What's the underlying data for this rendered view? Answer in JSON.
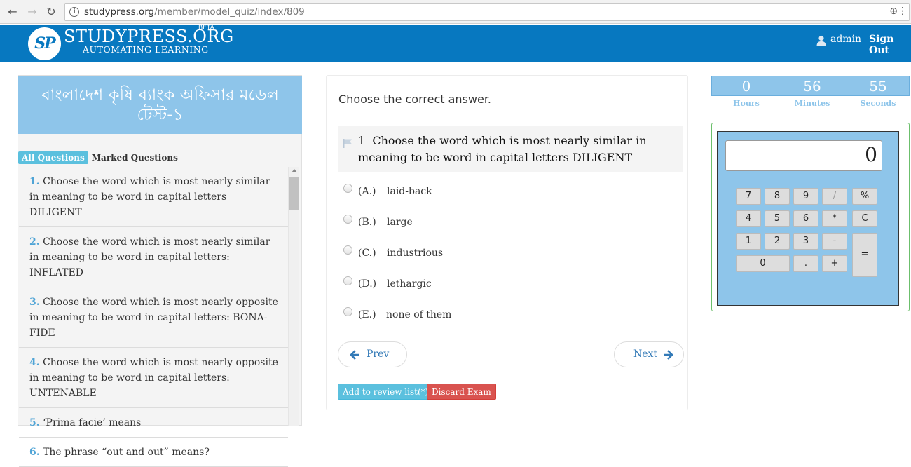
{
  "browser": {
    "url_domain": "studypress.org",
    "url_path": "/member/model_quiz/index/809"
  },
  "header": {
    "logo_mark": "SP",
    "logo_name": "STUDYPRESS.ORG",
    "logo_badge": "BETA",
    "logo_tagline": "AUTOMATING LEARNING",
    "user": "admin",
    "signout": "Sign Out"
  },
  "sidebar": {
    "exam_title": "বাংলাদেশ কৃষি ব্যাংক অফিসার মডেল টেস্ট-১",
    "tab_all": "All Questions",
    "tab_marked": "Marked Questions",
    "questions": [
      {
        "num": "1.",
        "text": "Choose the word which is most nearly similar in meaning to be word in capital letters DILIGENT"
      },
      {
        "num": "2.",
        "text": "Choose the word which is most nearly similar in meaning to be word in capital letters: INFLATED"
      },
      {
        "num": "3.",
        "text": "Choose the word which is most nearly opposite in meaning to be word in capital letters: BONA-FIDE"
      },
      {
        "num": "4.",
        "text": "Choose the word which is most nearly opposite in meaning to be word in capital letters: UNTENABLE"
      },
      {
        "num": "5.",
        "text": "‘Prima facie’ means"
      },
      {
        "num": "6.",
        "text": "The phrase “out and out” means?"
      }
    ]
  },
  "main": {
    "instruction": "Choose the correct answer.",
    "question_number": "1",
    "question_text": "Choose the word which is most nearly similar in meaning to be word in capital letters DILIGENT",
    "options": [
      {
        "letter": "(A.)",
        "text": "laid-back"
      },
      {
        "letter": "(B.)",
        "text": "large"
      },
      {
        "letter": "(C.)",
        "text": "industrious"
      },
      {
        "letter": "(D.)",
        "text": "lethargic"
      },
      {
        "letter": "(E.)",
        "text": "none of them"
      }
    ],
    "prev_label": "Prev",
    "next_label": "Next",
    "review_label": "Add to review list(*)",
    "discard_label": "Discard Exam"
  },
  "timer": {
    "hours": "0",
    "minutes": "56",
    "seconds": "55",
    "hours_label": "Hours",
    "minutes_label": "Minutes",
    "seconds_label": "Seconds"
  },
  "calculator": {
    "display": "0",
    "keys": [
      "7",
      "8",
      "9",
      "/",
      "%",
      "4",
      "5",
      "6",
      "*",
      "C",
      "1",
      "2",
      "3",
      "-",
      "=",
      "0",
      ".",
      "+"
    ]
  },
  "colors": {
    "header_bg": "#0778c0",
    "accent_light_blue": "#8ec5ea",
    "info": "#5bc0de",
    "danger": "#d9534f",
    "link": "#337ab7"
  }
}
